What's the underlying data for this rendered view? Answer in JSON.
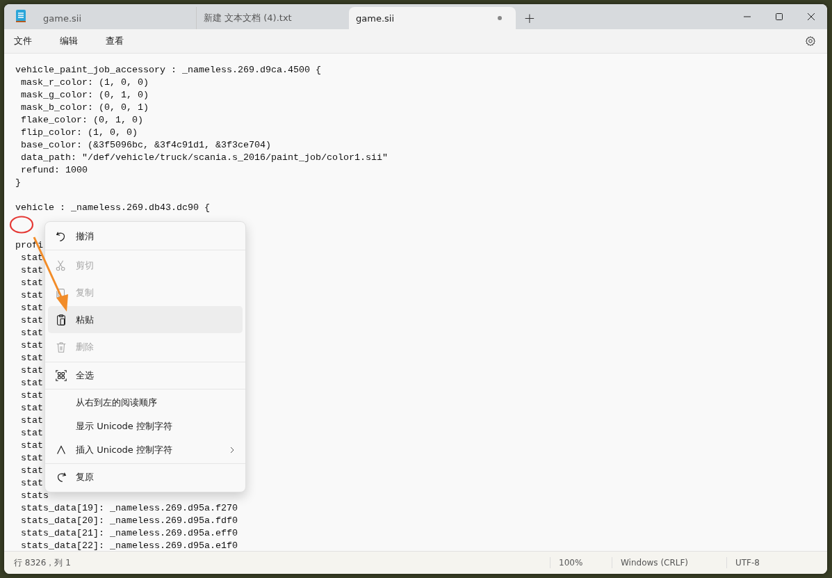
{
  "tabs": [
    {
      "label": "game.sii",
      "selected": false,
      "modified": false
    },
    {
      "label": "新建 文本文档 (4).txt",
      "selected": false,
      "modified": false
    },
    {
      "label": "game.sii",
      "selected": true,
      "modified": true
    }
  ],
  "new_tab": "+",
  "menu_bar": [
    "文件",
    "编辑",
    "查看"
  ],
  "code_blocks": [
    [
      "vehicle_paint_job_accessory : _nameless.269.d9ca.4500 {",
      " mask_r_color: (1, 0, 0)",
      " mask_g_color: (0, 1, 0)",
      " mask_b_color: (0, 0, 1)",
      " flake_color: (0, 1, 0)",
      " flip_color: (1, 0, 0)",
      " base_color: (&3f5096bc, &3f4c91d1, &3f3ce704)",
      " data_path: \"/def/vehicle/truck/scania.s_2016/paint_job/color1.sii\"",
      " refund: 1000",
      "}"
    ],
    [
      "vehicle : _nameless.269.db43.dc90 {"
    ],
    [
      "profi",
      " stat",
      " stat",
      " stat",
      " stat",
      " stat",
      " stat",
      " stat",
      " stat",
      " stat",
      " stat",
      " stat",
      " stat",
      " stat",
      " stat",
      " stat",
      " stat",
      " stat",
      " stat",
      " stat",
      " stats",
      " stats_data[19]: _nameless.269.d95a.f270",
      " stats_data[20]: _nameless.269.d95a.fdf0",
      " stats_data[21]: _nameless.269.d95a.eff0",
      " stats_data[22]: _nameless.269.d95a.e1f0"
    ]
  ],
  "context_menu": {
    "groups": [
      [
        {
          "label": "撤消",
          "disabled": false,
          "selected": false
        }
      ],
      [
        {
          "label": "剪切",
          "disabled": true,
          "selected": false
        },
        {
          "label": "复制",
          "disabled": true,
          "selected": false
        },
        {
          "label": "粘贴",
          "disabled": false,
          "selected": true
        },
        {
          "label": "删除",
          "disabled": true,
          "selected": false
        }
      ],
      [
        {
          "label": "全选",
          "disabled": false,
          "selected": false
        }
      ],
      [
        {
          "label": "从右到左的阅读顺序",
          "disabled": false,
          "selected": false
        },
        {
          "label": "显示 Unicode 控制字符",
          "disabled": false,
          "selected": false
        },
        {
          "label": "插入 Unicode 控制字符",
          "disabled": false,
          "selected": false,
          "submenu": true
        }
      ],
      [
        {
          "label": "复原",
          "disabled": false,
          "selected": false
        }
      ]
    ]
  },
  "status_bar": {
    "position": "行 8326，列 1",
    "zoom": "100%",
    "line_ending": "Windows (CRLF)",
    "encoding": "UTF-8"
  }
}
